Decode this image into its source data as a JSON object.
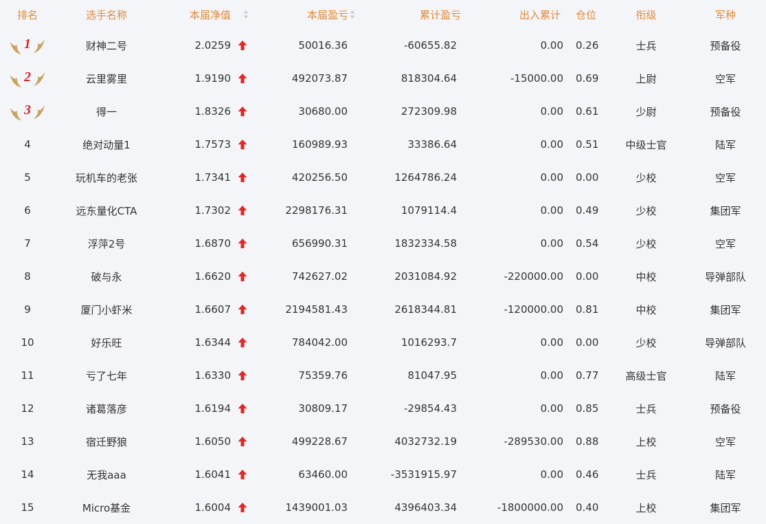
{
  "header": {
    "rank": "排名",
    "name": "选手名称",
    "nav": "本届净值",
    "pnl": "本届盈亏",
    "cum_pnl": "累计盈亏",
    "in_out": "出入累计",
    "position": "仓位",
    "title_rank": "衔级",
    "arm": "军种"
  },
  "colors": {
    "header_text": "#e08a3c",
    "up_arrow": "#e02828",
    "medal_number": "#d8262c",
    "medal_wing": "#c8a566",
    "background": "#f4f5f8"
  },
  "rows": [
    {
      "rank": "1",
      "name": "财神二号",
      "nav": "2.0259",
      "pnl": "50016.36",
      "cum_pnl": "-60655.82",
      "in_out": "0.00",
      "position": "0.26",
      "title_rank": "士兵",
      "arm": "预备役"
    },
    {
      "rank": "2",
      "name": "云里雾里",
      "nav": "1.9190",
      "pnl": "492073.87",
      "cum_pnl": "818304.64",
      "in_out": "-15000.00",
      "position": "0.69",
      "title_rank": "上尉",
      "arm": "空军"
    },
    {
      "rank": "3",
      "name": "得一",
      "nav": "1.8326",
      "pnl": "30680.00",
      "cum_pnl": "272309.98",
      "in_out": "0.00",
      "position": "0.61",
      "title_rank": "少尉",
      "arm": "预备役"
    },
    {
      "rank": "4",
      "name": "绝对动量1",
      "nav": "1.7573",
      "pnl": "160989.93",
      "cum_pnl": "33386.64",
      "in_out": "0.00",
      "position": "0.51",
      "title_rank": "中级士官",
      "arm": "陆军"
    },
    {
      "rank": "5",
      "name": "玩机车的老张",
      "nav": "1.7341",
      "pnl": "420256.50",
      "cum_pnl": "1264786.24",
      "in_out": "0.00",
      "position": "0.00",
      "title_rank": "少校",
      "arm": "空军"
    },
    {
      "rank": "6",
      "name": "远东量化CTA",
      "nav": "1.7302",
      "pnl": "2298176.31",
      "cum_pnl": "1079114.4",
      "in_out": "0.00",
      "position": "0.49",
      "title_rank": "少校",
      "arm": "集团军"
    },
    {
      "rank": "7",
      "name": "浮萍2号",
      "nav": "1.6870",
      "pnl": "656990.31",
      "cum_pnl": "1832334.58",
      "in_out": "0.00",
      "position": "0.54",
      "title_rank": "少校",
      "arm": "空军"
    },
    {
      "rank": "8",
      "name": "破与永",
      "nav": "1.6620",
      "pnl": "742627.02",
      "cum_pnl": "2031084.92",
      "in_out": "-220000.00",
      "position": "0.00",
      "title_rank": "中校",
      "arm": "导弹部队"
    },
    {
      "rank": "9",
      "name": "厦门小虾米",
      "nav": "1.6607",
      "pnl": "2194581.43",
      "cum_pnl": "2618344.81",
      "in_out": "-120000.00",
      "position": "0.81",
      "title_rank": "中校",
      "arm": "集团军"
    },
    {
      "rank": "10",
      "name": "好乐旺",
      "nav": "1.6344",
      "pnl": "784042.00",
      "cum_pnl": "1016293.7",
      "in_out": "0.00",
      "position": "0.00",
      "title_rank": "少校",
      "arm": "导弹部队"
    },
    {
      "rank": "11",
      "name": "亏了七年",
      "nav": "1.6330",
      "pnl": "75359.76",
      "cum_pnl": "81047.95",
      "in_out": "0.00",
      "position": "0.77",
      "title_rank": "高级士官",
      "arm": "陆军"
    },
    {
      "rank": "12",
      "name": "诸葛落彦",
      "nav": "1.6194",
      "pnl": "30809.17",
      "cum_pnl": "-29854.43",
      "in_out": "0.00",
      "position": "0.85",
      "title_rank": "士兵",
      "arm": "预备役"
    },
    {
      "rank": "13",
      "name": "宿迁野狼",
      "nav": "1.6050",
      "pnl": "499228.67",
      "cum_pnl": "4032732.19",
      "in_out": "-289530.00",
      "position": "0.88",
      "title_rank": "上校",
      "arm": "空军"
    },
    {
      "rank": "14",
      "name": "无我aaa",
      "nav": "1.6041",
      "pnl": "63460.00",
      "cum_pnl": "-3531915.97",
      "in_out": "0.00",
      "position": "0.46",
      "title_rank": "士兵",
      "arm": "陆军"
    },
    {
      "rank": "15",
      "name": "Micro基金",
      "nav": "1.6004",
      "pnl": "1439001.03",
      "cum_pnl": "4396403.34",
      "in_out": "-1800000.00",
      "position": "0.40",
      "title_rank": "上校",
      "arm": "集团军"
    }
  ]
}
